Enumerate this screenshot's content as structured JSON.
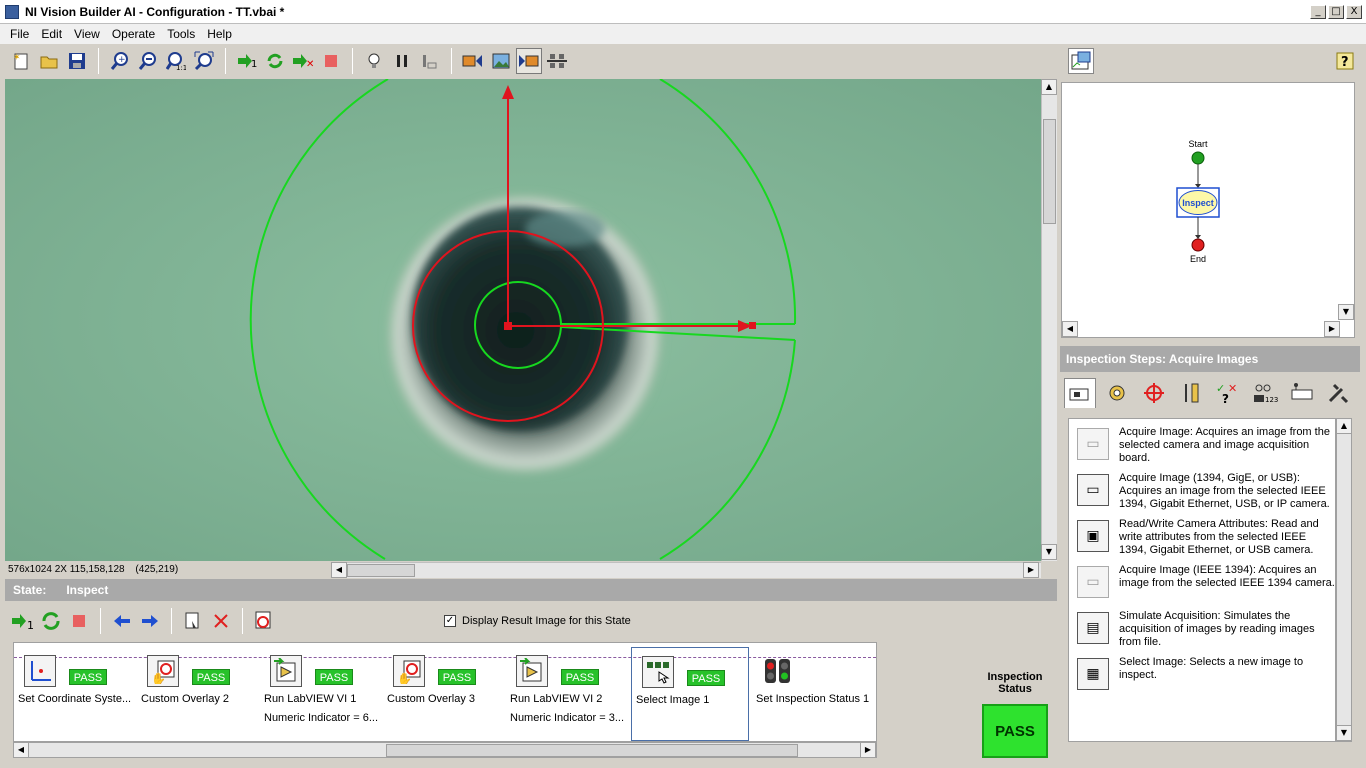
{
  "window": {
    "title": "NI Vision Builder AI - Configuration - TT.vbai *",
    "minimize": "_",
    "maximize": "□",
    "close": "X"
  },
  "menu": [
    "File",
    "Edit",
    "View",
    "Operate",
    "Tools",
    "Help"
  ],
  "toolbar": {
    "groups": [
      [
        "new-icon",
        "open-icon",
        "save-icon"
      ],
      [
        "zoom-in-icon",
        "zoom-out-icon",
        "zoom-1to1-icon",
        "zoom-fit-icon"
      ],
      [
        "run-once-icon",
        "run-continuous-icon",
        "stop-run-icon",
        "stop-icon"
      ],
      [
        "lightbulb-icon",
        "pause-icon",
        "step-icon"
      ],
      [
        "view-image-icon",
        "view-result-icon",
        "view-both-icon",
        "view-network-icon"
      ]
    ]
  },
  "image": {
    "info": "576x1024 2X 115,158,128",
    "coords": "(425,219)",
    "background_color": "#7fb192",
    "overlay_green": "#17d81f",
    "overlay_red": "#e0141e"
  },
  "state": {
    "label": "State:",
    "name": "Inspect"
  },
  "display_result": {
    "label": "Display Result Image for this State",
    "checked": true,
    "check_glyph": "✓"
  },
  "steps": [
    {
      "label": "Set Coordinate Syste...",
      "sub": "",
      "status": "PASS",
      "icon": "coordinate-icon"
    },
    {
      "label": "Custom Overlay 2",
      "sub": "",
      "status": "PASS",
      "icon": "overlay-icon"
    },
    {
      "label": "Run LabVIEW VI 1",
      "sub": "Numeric Indicator = 6...",
      "status": "PASS",
      "icon": "labview-icon"
    },
    {
      "label": "Custom Overlay 3",
      "sub": "",
      "status": "PASS",
      "icon": "overlay-icon"
    },
    {
      "label": "Run LabVIEW VI 2",
      "sub": "Numeric Indicator = 3...",
      "status": "PASS",
      "icon": "labview-icon"
    },
    {
      "label": "Select Image 1",
      "sub": "",
      "status": "PASS",
      "icon": "select-image-icon",
      "selected": true
    },
    {
      "label": "Set Inspection Status 1",
      "sub": "",
      "status": "",
      "icon": "traffic-light-icon"
    }
  ],
  "inspection_status": {
    "label": "Inspection Status",
    "value": "PASS"
  },
  "flow": {
    "start": "Start",
    "inspect": "Inspect",
    "end": "End"
  },
  "inspection_steps": {
    "header": "Inspection Steps: Acquire Images",
    "tabs": [
      "acquire-images-icon",
      "enhance-images-icon",
      "locate-features-icon",
      "measure-features-icon",
      "check-presence-icon",
      "identify-parts-icon",
      "communicate-icon",
      "use-additional-tools-icon"
    ],
    "items": [
      {
        "title": "Acquire Image:",
        "desc": "Acquires an image from the selected camera and image acquisition board.",
        "dim": true
      },
      {
        "title": "Acquire Image (1394, GigE, or USB):",
        "desc": "Acquires an image from the selected IEEE 1394, Gigabit Ethernet, USB, or IP camera.",
        "dim": false
      },
      {
        "title": "Read/Write Camera Attributes:",
        "desc": "Read and write attributes from the selected IEEE 1394, Gigabit Ethernet, or USB camera.",
        "dim": false
      },
      {
        "title": "Acquire Image (IEEE 1394):",
        "desc": "Acquires an image from the selected IEEE 1394 camera.",
        "dim": true
      },
      {
        "title": "Simulate Acquisition:",
        "desc": "Simulates the acquisition of images by reading images from file.",
        "dim": false
      },
      {
        "title": "Select Image:",
        "desc": "Selects a new image to inspect.",
        "dim": false
      }
    ]
  }
}
